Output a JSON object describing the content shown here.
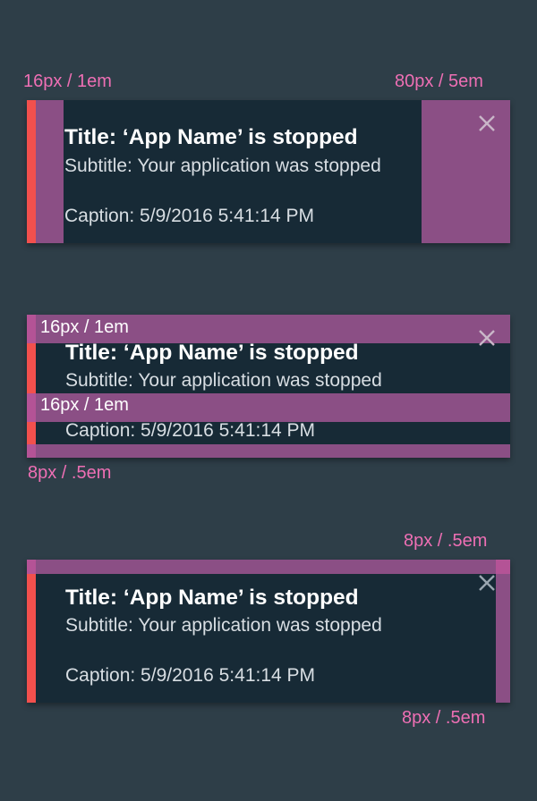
{
  "notification": {
    "title": "Title: ‘App Name’ is stopped",
    "subtitle": "Subtitle: Your application was stopped",
    "caption": "Caption: 5/9/2016 5:41:14 PM",
    "close_icon": "close-icon"
  },
  "example1": {
    "left_label": "16px / 1em",
    "right_label": "80px / 5em"
  },
  "example2": {
    "top_label": "16px / 1em",
    "middle_label": "16px / 1em",
    "bottom_label": "8px / .5em"
  },
  "example3": {
    "top_label": "8px / .5em",
    "right_label": "8px / .5em"
  },
  "colors": {
    "background": "#2e3e48",
    "card": "#172a36",
    "accent": "#f2504d",
    "spacing_overlay": "#8b4f85",
    "spec_text": "#ee6fb4"
  }
}
